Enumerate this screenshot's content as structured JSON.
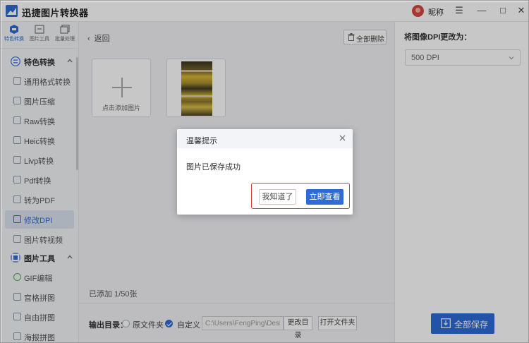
{
  "app": {
    "title": "迅捷图片转换器",
    "nickname": "昵称",
    "window_controls": {
      "menu": "☰",
      "minimize": "—",
      "maximize": "□",
      "close": "✕"
    }
  },
  "sidebar": {
    "top_tabs": [
      {
        "label": "特色转换",
        "icon": "hexagon-icon",
        "active": true
      },
      {
        "label": "图片工具",
        "icon": "image-tool-icon",
        "active": false
      },
      {
        "label": "批量处理",
        "icon": "batch-icon",
        "active": false
      }
    ],
    "sections": [
      {
        "title": "特色转换",
        "icon": "feature-icon",
        "items": [
          {
            "label": "通用格式转换",
            "active": false
          },
          {
            "label": "图片压缩",
            "active": false
          },
          {
            "label": "Raw转换",
            "active": false
          },
          {
            "label": "Heic转换",
            "active": false
          },
          {
            "label": "Livp转换",
            "active": false
          },
          {
            "label": "Pdf转换",
            "active": false
          },
          {
            "label": "转为PDF",
            "active": false
          },
          {
            "label": "修改DPI",
            "active": true
          },
          {
            "label": "图片转视频",
            "active": false
          }
        ]
      },
      {
        "title": "图片工具",
        "icon": "tool-icon",
        "items": [
          {
            "label": "GIF编辑",
            "active": false
          },
          {
            "label": "宫格拼图",
            "active": false
          },
          {
            "label": "自由拼图",
            "active": false
          },
          {
            "label": "海报拼图",
            "active": false
          }
        ]
      }
    ]
  },
  "main": {
    "back_label": "返回",
    "delete_all_label": "全部删除",
    "add_image_label": "点击添加图片",
    "added_count": "已添加 1/50张",
    "output": {
      "label": "输出目录：",
      "option_original": "原文件夹",
      "option_custom": "自定义",
      "selected": "自定义",
      "path_value": "C:\\Users\\FengPing\\Desk",
      "change_dir_label": "更改目录",
      "open_folder_label": "打开文件夹"
    }
  },
  "right_panel": {
    "dpi_label": "将图像DPI更改为：",
    "dpi_value": "500 DPI",
    "save_all_label": "全部保存"
  },
  "dialog": {
    "title": "温馨提示",
    "message": "图片已保存成功",
    "btn_ok": "我知道了",
    "btn_view": "立即查看"
  },
  "colors": {
    "accent": "#2d6bd6",
    "highlight": "#d93c3c"
  }
}
